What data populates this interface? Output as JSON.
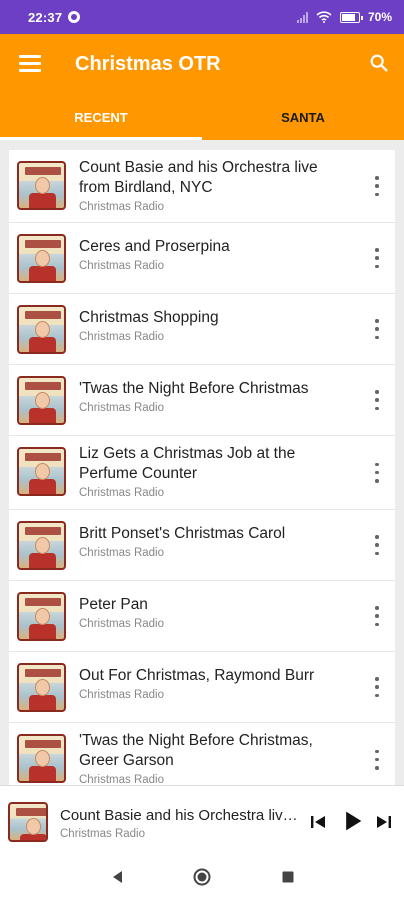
{
  "status": {
    "time": "22:37",
    "battery": "70",
    "battery_level": 0.7
  },
  "app": {
    "title": "Christmas OTR",
    "accent_color": "#ff9800",
    "status_color": "#6c3fc4"
  },
  "tabs": [
    {
      "label": "RECENT",
      "selected": true
    },
    {
      "label": "SANTA",
      "selected": false
    }
  ],
  "episodes": [
    {
      "title": "Count Basie and his Orchestra live from Birdland, NYC",
      "subtitle": "Christmas Radio"
    },
    {
      "title": "Ceres and Proserpina",
      "subtitle": "Christmas Radio"
    },
    {
      "title": "Christmas Shopping",
      "subtitle": "Christmas Radio"
    },
    {
      "title": "'Twas the Night Before Christmas",
      "subtitle": "Christmas Radio"
    },
    {
      "title": "Liz Gets a Christmas Job at the Perfume Counter",
      "subtitle": "Christmas Radio"
    },
    {
      "title": "Britt Ponset's Christmas Carol",
      "subtitle": "Christmas Radio"
    },
    {
      "title": "Peter Pan",
      "subtitle": "Christmas Radio"
    },
    {
      "title": "Out For Christmas, Raymond Burr",
      "subtitle": "Christmas Radio"
    },
    {
      "title": "'Twas the Night Before Christmas, Greer Garson",
      "subtitle": "Christmas Radio"
    }
  ],
  "player": {
    "title": "Count Basie and his Orchestra live from Birdland, NYC",
    "subtitle": "Christmas Radio"
  }
}
